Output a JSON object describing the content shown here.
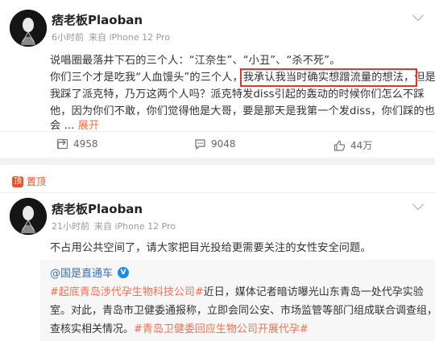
{
  "post1": {
    "author": "痞老板Plaoban",
    "time": "6小时前",
    "source": "来自 iPhone 12 Pro",
    "line1": "说唱圈最落井下石的三个人：“江奈生”、“小丑”、“杀不死”。",
    "line2a": "你们三个才是吃我“人血馒头”的三个人，",
    "line2_highlight": "我承认我当时确实想蹭流量的想法，",
    "line2b": "但是",
    "line3": "我踩了派克特，乃万这两个人吗？派克特发diss引起的轰动的时候你们怎么不踩",
    "line4": "他，因为你们不敢，你们觉得他是大哥，要是那天是我第一个发diss，你们踩的也",
    "line5": "会 ...",
    "expand": "展开",
    "repost_count": "4958",
    "comment_count": "9048",
    "like_count": "44万"
  },
  "post2": {
    "pinned_label": "置顶",
    "pinned_mark": "顶",
    "author": "痞老板Plaoban",
    "time": "21小时前",
    "source": "来自 iPhone 12 Pro",
    "text": "不占用公共空间了，请大家把目光投给更需要关注的女性安全问题。",
    "repost": {
      "author": "@国是直通车",
      "badge": "V",
      "tag1": "#起底青岛涉代孕生物科技公司#",
      "line1_rest": "近日，媒体记者暗访曝光山东青岛一处代孕实验",
      "line2": "室。对此，青岛市卫健委通报称，立即会同公安、市场监管等部门组成联合调查组，调",
      "line3": "查核实相关情况。",
      "tag2": "#青岛卫健委回应生物公司开展代孕#"
    }
  },
  "colors": {
    "accent": "#eb7350",
    "highlight_box": "#e0362c",
    "link": "#3d6fa6",
    "verified": "#1c8bf0"
  }
}
